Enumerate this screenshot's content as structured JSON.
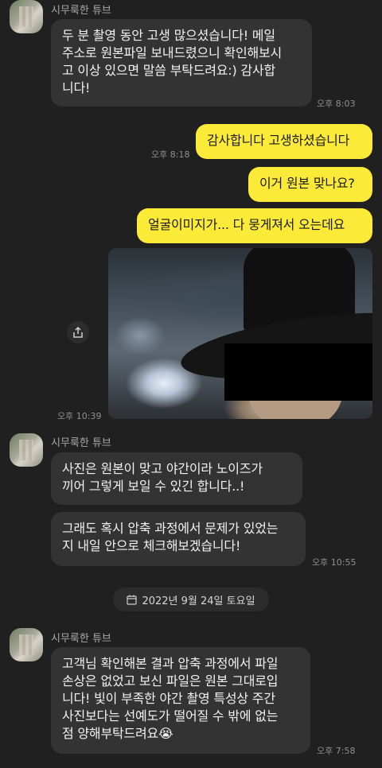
{
  "sender_name": "시무룩한 튜브",
  "messages": {
    "m1": {
      "lines": [
        "두 분 촬영 동안 고생 많으셨습니다! 메일",
        "주소로 원본파일 보내드렸으니 확인해보시",
        "고 이상 있으면 말씀 부탁드려요:) 감사합",
        "니다!"
      ],
      "time": "오후 8:03"
    },
    "m2": {
      "text": "감사합니다 고생하셨습니다",
      "time": "오후 8:18"
    },
    "m3": {
      "text": "이거 원본 맞나요?"
    },
    "m4": {
      "text": "얼굴이미지가... 다 뭉게져서 오는데요"
    },
    "photo_time": "오후 10:39",
    "m5": {
      "lines": [
        "사진은 원본이 맞고 야간이라 노이즈가",
        "끼어 그렇게 보일 수 있긴 합니다..!"
      ]
    },
    "m6": {
      "lines": [
        "그래도 혹시 압축 과정에서 문제가 있었는",
        "지 내일 안으로 체크해보겠습니다!"
      ],
      "time": "오후 10:55"
    },
    "date_divider": "2022년 9월 24일 토요일",
    "m7": {
      "lines": [
        "고객님 확인해본 결과 압축 과정에서 파일",
        "손상은 없었고 보신 파일은 원본 그대로입",
        "니다! 빛이 부족한 야간 촬영 특성상 주간",
        "사진보다는 선예도가 떨어질 수 밖에 없는",
        "점 양해부탁드려요😭"
      ],
      "time": "오후 7:58"
    }
  },
  "icons": {
    "share": "share-icon",
    "calendar": "calendar-icon"
  },
  "colors": {
    "background": "#202020",
    "incoming_bubble": "#333333",
    "outgoing_bubble": "#fcea39"
  }
}
